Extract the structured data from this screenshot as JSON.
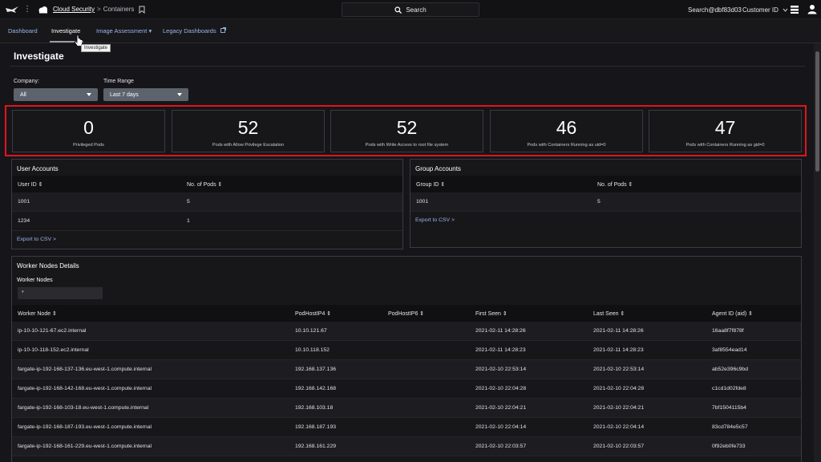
{
  "topbar": {
    "brand": "Cloud Security",
    "crumb_separator": ">",
    "crumb": "Containers",
    "search_label": "Search",
    "search_term": "Search@dbf83d03",
    "customer_label": "Customer ID",
    "icons": [
      "falcon-logo-icon",
      "menu-dots-icon",
      "cloud-icon",
      "bookmark-icon",
      "search-icon",
      "menu-icon",
      "user-icon"
    ]
  },
  "nav": {
    "tabs": [
      {
        "label": "Dashboard"
      },
      {
        "label": "Investigate"
      },
      {
        "label": "Image Assessment ▾"
      },
      {
        "label": "Legacy Dashboards"
      }
    ],
    "tooltip": "Investigate"
  },
  "page": {
    "title": "Investigate",
    "company_label": "Company:",
    "company_value": "All",
    "time_label": "Time Range",
    "time_value": "Last 7 days"
  },
  "stats": [
    {
      "value": "0",
      "label": "Privileged Pods"
    },
    {
      "value": "52",
      "label": "Pods with Allow Privilege Escalation"
    },
    {
      "value": "52",
      "label": "Pods with Write Access to root file system"
    },
    {
      "value": "46",
      "label": "Pods with Containers Running as uid=0"
    },
    {
      "value": "47",
      "label": "Pods with Containers Running as gid=0"
    }
  ],
  "user_accounts": {
    "title": "User Accounts",
    "columns": [
      "User ID ⇕",
      "No. of Pods ⇕"
    ],
    "rows": [
      [
        "1001",
        "5"
      ],
      [
        "1234",
        "1"
      ]
    ],
    "export": "Export to CSV >"
  },
  "group_accounts": {
    "title": "Group Accounts",
    "columns": [
      "Group ID ⇕",
      "No. of Pods ⇕"
    ],
    "rows": [
      [
        "1001",
        "5"
      ]
    ],
    "export": "Export to CSV >"
  },
  "worker_nodes": {
    "title": "Worker Nodes Details",
    "filter_label": "Worker Nodes",
    "filter_value": "*",
    "columns": [
      "Worker Node ⇕",
      "PodHostIP4 ⇕",
      "PodHostIP6 ⇕",
      "First Seen ⇕",
      "Last Seen ⇕",
      "Agent ID (aid) ⇕"
    ],
    "rows": [
      [
        "ip-10-10-121-67.ec2.internal",
        "10.10.121.67",
        "",
        "2021-02-11 14:28:26",
        "2021-02-11 14:28:26",
        "16aa8f7f878f"
      ],
      [
        "ip-10-10-118-152.ec2.internal",
        "10.10.118.152",
        "",
        "2021-02-11 14:28:23",
        "2021-02-11 14:28:23",
        "3af8554ead14"
      ],
      [
        "fargate-ip-192-168-137-136.eu-west-1.compute.internal",
        "192.168.137.136",
        "",
        "2021-02-10 22:53:14",
        "2021-02-10 22:53:14",
        "ab52e396c9bd"
      ],
      [
        "fargate-ip-192-168-142-168.eu-west-1.compute.internal",
        "192.168.142.168",
        "",
        "2021-02-10 22:04:28",
        "2021-02-10 22:04:28",
        "c1cd1d02fde8"
      ],
      [
        "fargate-ip-192-168-103-18.eu-west-1.compute.internal",
        "192.168.103.18",
        "",
        "2021-02-10 22:04:21",
        "2021-02-10 22:04:21",
        "7bf1504115b4"
      ],
      [
        "fargate-ip-192-168-187-193.eu-west-1.compute.internal",
        "192.168.187.193",
        "",
        "2021-02-10 22:04:14",
        "2021-02-10 22:04:14",
        "83cd784e5c57"
      ],
      [
        "fargate-ip-192-168-161-229.eu-west-1.compute.internal",
        "192.168.161.229",
        "",
        "2021-02-10 22:03:57",
        "2021-02-10 22:03:57",
        "0f92eb0fe733"
      ]
    ]
  },
  "colors": {
    "highlight": "#e0151b",
    "link": "#9bb6ea",
    "select": "#5c636c"
  }
}
